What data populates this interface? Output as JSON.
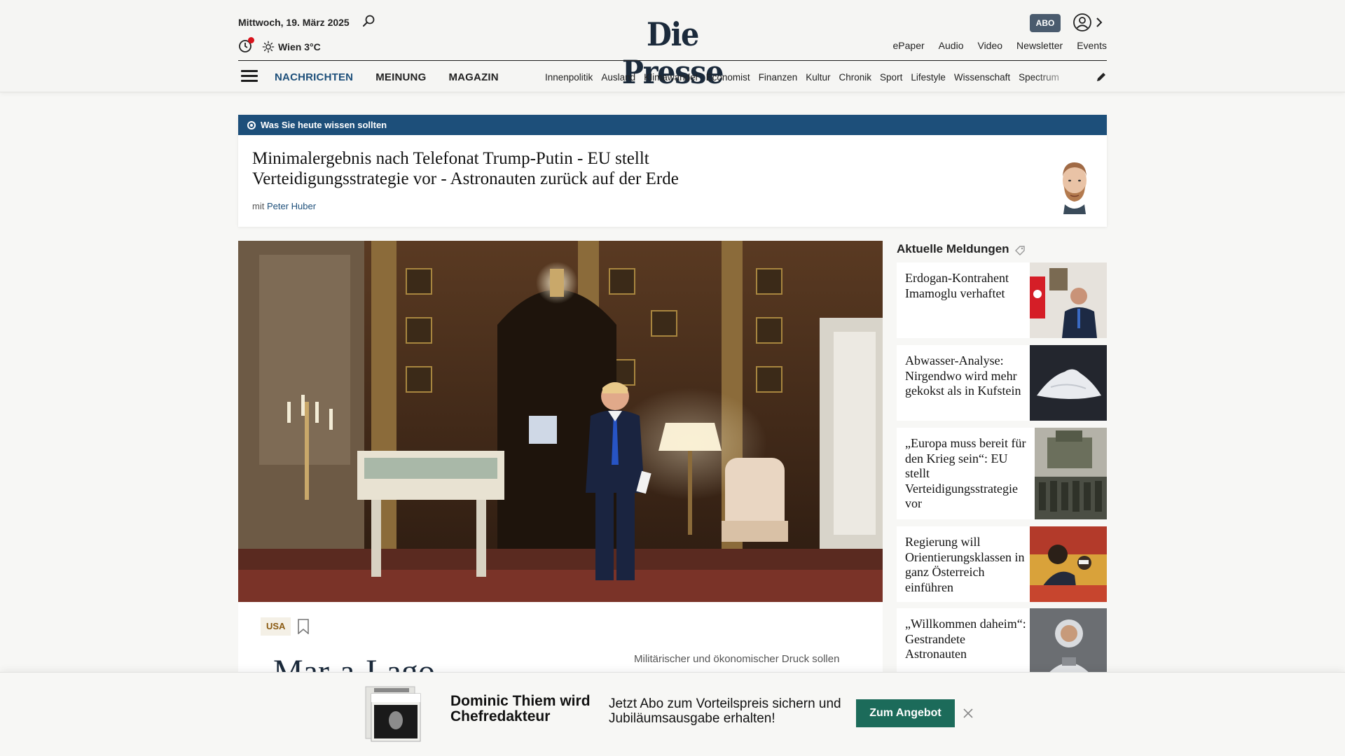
{
  "header": {
    "date": "Mittwoch, 19. März 2025",
    "weather": "Wien 3°C",
    "logo": "Die Presse",
    "abo_label": "ABO",
    "top_links": [
      "ePaper",
      "Audio",
      "Video",
      "Newsletter",
      "Events"
    ],
    "main_nav": [
      "NACHRICHTEN",
      "MEINUNG",
      "MAGAZIN"
    ],
    "sub_nav": [
      "Innenpolitik",
      "Ausland",
      "Klimawandel",
      "Economist",
      "Finanzen",
      "Kultur",
      "Chronik",
      "Sport",
      "Lifestyle",
      "Wissenschaft",
      "Spectrum"
    ]
  },
  "briefing": {
    "label": "Was Sie heute wissen sollten",
    "title": "Minimalergebnis nach Telefonat Trump-Putin - EU stellt Verteidigungsstrategie vor - Astronauten zurück auf der Erde",
    "author_prefix": "mit ",
    "author": "Peter Huber"
  },
  "hero": {
    "tag": "USA",
    "headline": "Mar-a-Lago-",
    "teaser": "Militärischer und ökonomischer Druck sollen"
  },
  "sidebar": {
    "title": "Aktuelle Meldungen",
    "items": [
      {
        "text": "Erdogan-Kontrahent Imamoglu verhaftet"
      },
      {
        "text": "Abwasser-Analyse: Nirgendwo wird mehr gekokst als in Kufstein"
      },
      {
        "text": "„Europa muss bereit für den Krieg sein“: EU stellt Verteidigungsstrategie vor"
      },
      {
        "text": "Regierung will Orientierungsklassen in ganz Österreich einführen"
      },
      {
        "text": "„Willkommen daheim“: Gestrandete Astronauten"
      }
    ]
  },
  "promo": {
    "title": "Dominic Thiem wird Chefredakteur",
    "text": "Jetzt Abo zum Vorteilspreis sichern und Jubiläumsausgabe erhalten!",
    "button": "Zum Angebot"
  },
  "colors": {
    "brand_blue": "#1d4f7a",
    "abo_bg": "#4a5b6e",
    "cta_green": "#1c6b5a",
    "notification_red": "#d8131c"
  }
}
